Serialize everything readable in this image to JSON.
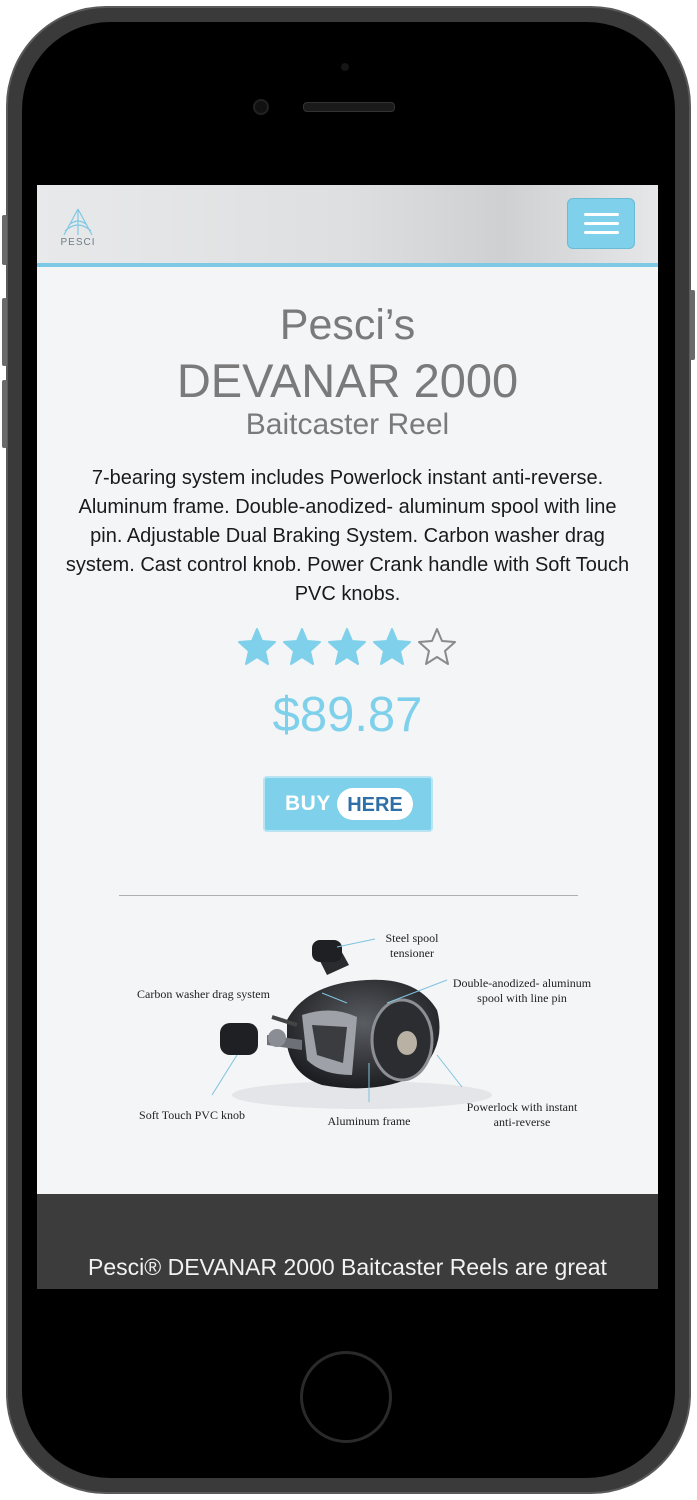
{
  "header": {
    "logo_text": "PESCI",
    "menu_icon": "hamburger-menu-icon"
  },
  "product": {
    "brand_line": "Pesci’s",
    "model": "DEVANAR 2000",
    "type": "Baitcaster Reel",
    "description": "7-bearing system includes Powerlock instant anti-reverse. Aluminum frame. Double-anodized- aluminum spool with line pin. Adjustable Dual Braking System. Carbon washer drag system. Cast control knob. Power Crank handle with Soft Touch PVC knobs.",
    "rating": 4,
    "rating_max": 5,
    "price": "$89.87",
    "buy_label_left": "BUY",
    "buy_label_right": "HERE"
  },
  "diagram": {
    "labels": {
      "steel_spool": "Steel spool\ntensioner",
      "carbon_washer": "Carbon washer drag system",
      "double_anodized": "Double-anodized- aluminum\nspool with line pin",
      "soft_touch": "Soft Touch PVC knob",
      "aluminum_frame": "Aluminum frame",
      "powerlock": "Powerlock with instant\nanti-reverse"
    }
  },
  "footer": {
    "teaser": "Pesci® DEVANAR 2000 Baitcaster Reels are great"
  },
  "colors": {
    "accent": "#7fd0ea",
    "title_gray": "#7a7a7a",
    "footer_bg": "#3c3c3c",
    "buy_text_blue": "#2f6fa7"
  }
}
